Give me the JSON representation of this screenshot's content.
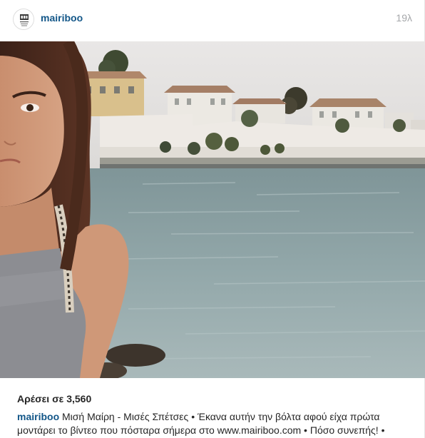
{
  "post": {
    "username": "mairiboo",
    "timestamp": "19λ",
    "avatar_icon": "mairiboo-logo-icon",
    "likes_text": "Αρέσει σε 3,560",
    "caption_user": "mairiboo",
    "caption_text": "Μισή Μαίρη - Μισές Σπέτσες • Έκανα αυτήν την βόλτα αφού είχα πρώτα μοντάρει το βίντεο που πόσταρα σήμερα στο www.mairiboo.com • Πόσο συνεπής! •"
  },
  "colors": {
    "link": "#125688",
    "timestamp": "#a5a7aa",
    "text": "#262626"
  }
}
